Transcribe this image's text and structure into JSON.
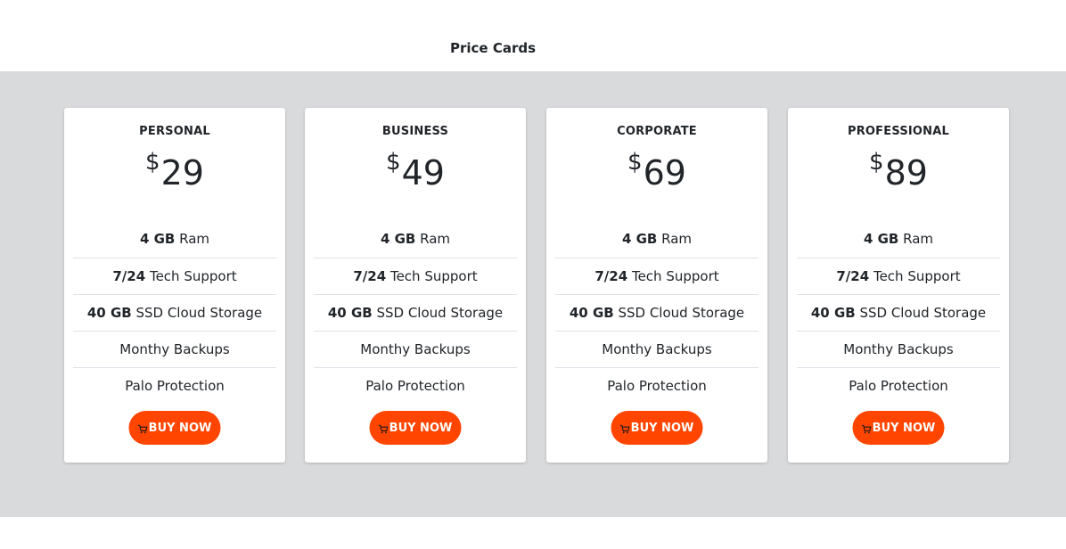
{
  "header": {
    "title": "Price Cards"
  },
  "colors": {
    "accent": "#ff4500",
    "band_background": "#d9dadb",
    "card_background": "#ffffff"
  },
  "cards": [
    {
      "plan": "PERSONAL",
      "currency": "$",
      "price": "29",
      "features": [
        {
          "bold": "4 GB",
          "text": "Ram"
        },
        {
          "bold": "7/24",
          "text": "Tech Support"
        },
        {
          "bold": "40 GB",
          "text": "SSD Cloud Storage"
        },
        {
          "bold": "",
          "text": "Monthy Backups"
        },
        {
          "bold": "",
          "text": "Palo Protection"
        }
      ],
      "button": {
        "icon": "cart-icon",
        "label": "BUY NOW"
      }
    },
    {
      "plan": "BUSINESS",
      "currency": "$",
      "price": "49",
      "features": [
        {
          "bold": "4 GB",
          "text": "Ram"
        },
        {
          "bold": "7/24",
          "text": "Tech Support"
        },
        {
          "bold": "40 GB",
          "text": "SSD Cloud Storage"
        },
        {
          "bold": "",
          "text": "Monthy Backups"
        },
        {
          "bold": "",
          "text": "Palo Protection"
        }
      ],
      "button": {
        "icon": "cart-icon",
        "label": "BUY NOW"
      }
    },
    {
      "plan": "CORPORATE",
      "currency": "$",
      "price": "69",
      "features": [
        {
          "bold": "4 GB",
          "text": "Ram"
        },
        {
          "bold": "7/24",
          "text": "Tech Support"
        },
        {
          "bold": "40 GB",
          "text": "SSD Cloud Storage"
        },
        {
          "bold": "",
          "text": "Monthy Backups"
        },
        {
          "bold": "",
          "text": "Palo Protection"
        }
      ],
      "button": {
        "icon": "cart-icon",
        "label": "BUY NOW"
      }
    },
    {
      "plan": "PROFESSIONAL",
      "currency": "$",
      "price": "89",
      "features": [
        {
          "bold": "4 GB",
          "text": "Ram"
        },
        {
          "bold": "7/24",
          "text": "Tech Support"
        },
        {
          "bold": "40 GB",
          "text": "SSD Cloud Storage"
        },
        {
          "bold": "",
          "text": "Monthy Backups"
        },
        {
          "bold": "",
          "text": "Palo Protection"
        }
      ],
      "button": {
        "icon": "cart-icon",
        "label": "BUY NOW"
      }
    }
  ]
}
